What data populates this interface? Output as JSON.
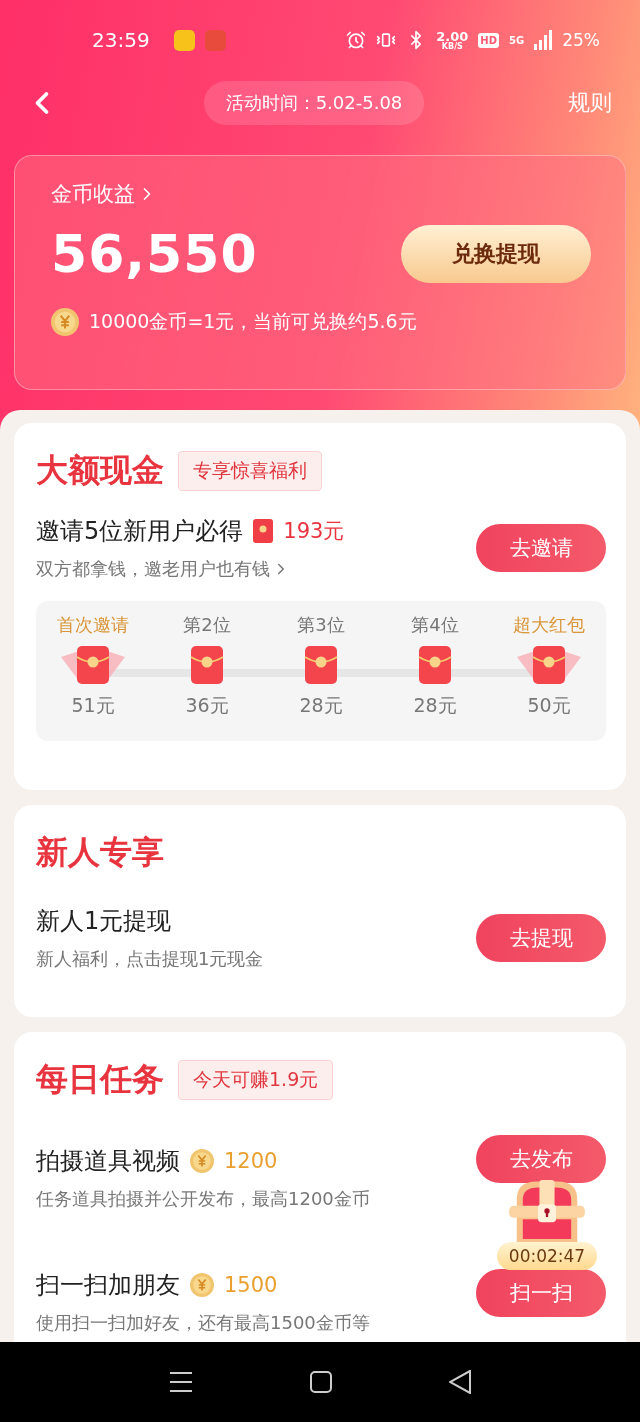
{
  "status_bar": {
    "time": "23:59",
    "speed": "2.00",
    "speed_unit": "KB/S",
    "hd": "HD",
    "network": "5G",
    "battery": "25%"
  },
  "header": {
    "period": "活动时间：5.02-5.08",
    "rules": "规则"
  },
  "earnings": {
    "label": "金币收益",
    "amount": "56,550",
    "button": "兑换提现",
    "rate": "10000金币=1元，当前可兑换约5.6元"
  },
  "big_cash": {
    "title": "大额现金",
    "tag": "专享惊喜福利",
    "task": "邀请5位新用户必得",
    "reward": "193元",
    "desc": "双方都拿钱，邀老用户也有钱",
    "button": "去邀请",
    "milestones": [
      {
        "label": "首次邀请",
        "amount": "51元",
        "highlight": true
      },
      {
        "label": "第2位",
        "amount": "36元",
        "highlight": false
      },
      {
        "label": "第3位",
        "amount": "28元",
        "highlight": false
      },
      {
        "label": "第4位",
        "amount": "28元",
        "highlight": false
      },
      {
        "label": "超大红包",
        "amount": "50元",
        "highlight": true
      }
    ]
  },
  "newcomer": {
    "title": "新人专享",
    "task": "新人1元提现",
    "desc": "新人福利，点击提现1元现金",
    "button": "去提现"
  },
  "daily": {
    "title": "每日任务",
    "tag": "今天可赚1.9元",
    "tasks": [
      {
        "name": "拍摄道具视频",
        "reward": "1200",
        "desc": "任务道具拍摄并公开发布，最高1200金币",
        "button": "去发布"
      },
      {
        "name": "扫一扫加朋友",
        "reward": "1500",
        "desc": "使用扫一扫加好友，还有最高1500金币等",
        "button": "扫一扫"
      }
    ]
  },
  "chest": {
    "timer": "00:02:47"
  }
}
